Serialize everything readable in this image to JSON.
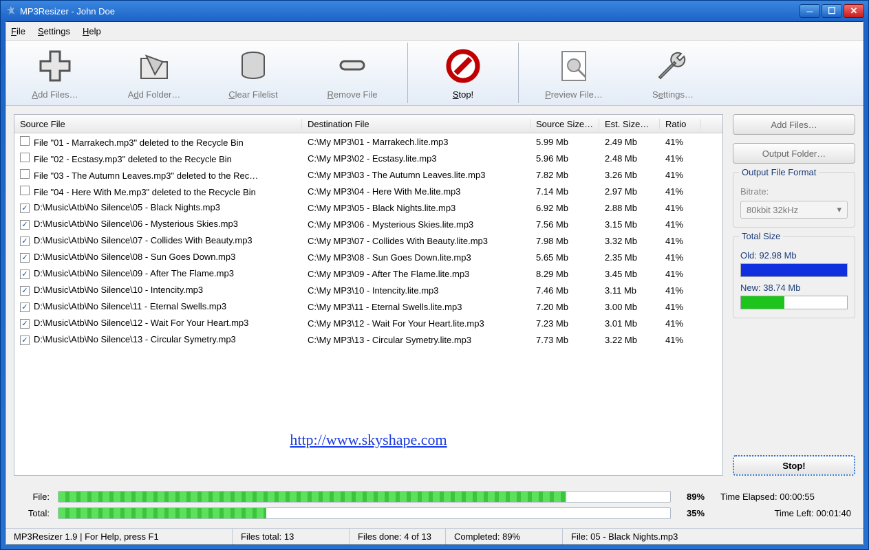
{
  "window": {
    "title": "MP3Resizer - John Doe"
  },
  "menu": {
    "file": "File",
    "settings": "Settings",
    "help": "Help"
  },
  "toolbar": {
    "add_files": "Add Files…",
    "add_folder": "Add Folder…",
    "clear": "Clear Filelist",
    "remove": "Remove File",
    "stop": "Stop!",
    "preview": "Preview File…",
    "settings": "Settings…"
  },
  "columns": {
    "source": "Source File",
    "dest": "Destination File",
    "src_size": "Source Size…",
    "est_size": "Est. Size…",
    "ratio": "Ratio"
  },
  "rows": [
    {
      "checked": false,
      "src": "File \"01 - Marrakech.mp3\" deleted to the Recycle Bin",
      "dst": "C:\\My MP3\\01 - Marrakech.lite.mp3",
      "src_size": "5.99 Mb",
      "est_size": "2.49 Mb",
      "ratio": "41%"
    },
    {
      "checked": false,
      "src": "File \"02 - Ecstasy.mp3\" deleted to the Recycle Bin",
      "dst": "C:\\My MP3\\02 - Ecstasy.lite.mp3",
      "src_size": "5.96 Mb",
      "est_size": "2.48 Mb",
      "ratio": "41%"
    },
    {
      "checked": false,
      "src": "File \"03 - The Autumn Leaves.mp3\" deleted to the Rec…",
      "dst": "C:\\My MP3\\03 - The Autumn Leaves.lite.mp3",
      "src_size": "7.82 Mb",
      "est_size": "3.26 Mb",
      "ratio": "41%"
    },
    {
      "checked": false,
      "src": "File \"04 - Here With Me.mp3\" deleted to the Recycle Bin",
      "dst": "C:\\My MP3\\04 - Here With Me.lite.mp3",
      "src_size": "7.14 Mb",
      "est_size": "2.97 Mb",
      "ratio": "41%"
    },
    {
      "checked": true,
      "src": "D:\\Music\\Atb\\No Silence\\05 - Black Nights.mp3",
      "dst": "C:\\My MP3\\05 - Black Nights.lite.mp3",
      "src_size": "6.92 Mb",
      "est_size": "2.88 Mb",
      "ratio": "41%"
    },
    {
      "checked": true,
      "src": "D:\\Music\\Atb\\No Silence\\06 - Mysterious Skies.mp3",
      "dst": "C:\\My MP3\\06 - Mysterious Skies.lite.mp3",
      "src_size": "7.56 Mb",
      "est_size": "3.15 Mb",
      "ratio": "41%"
    },
    {
      "checked": true,
      "src": "D:\\Music\\Atb\\No Silence\\07 - Collides With Beauty.mp3",
      "dst": "C:\\My MP3\\07 - Collides With Beauty.lite.mp3",
      "src_size": "7.98 Mb",
      "est_size": "3.32 Mb",
      "ratio": "41%"
    },
    {
      "checked": true,
      "src": "D:\\Music\\Atb\\No Silence\\08 - Sun Goes Down.mp3",
      "dst": "C:\\My MP3\\08 - Sun Goes Down.lite.mp3",
      "src_size": "5.65 Mb",
      "est_size": "2.35 Mb",
      "ratio": "41%"
    },
    {
      "checked": true,
      "src": "D:\\Music\\Atb\\No Silence\\09 - After The Flame.mp3",
      "dst": "C:\\My MP3\\09 - After The Flame.lite.mp3",
      "src_size": "8.29 Mb",
      "est_size": "3.45 Mb",
      "ratio": "41%"
    },
    {
      "checked": true,
      "src": "D:\\Music\\Atb\\No Silence\\10 - Intencity.mp3",
      "dst": "C:\\My MP3\\10 - Intencity.lite.mp3",
      "src_size": "7.46 Mb",
      "est_size": "3.11 Mb",
      "ratio": "41%"
    },
    {
      "checked": true,
      "src": "D:\\Music\\Atb\\No Silence\\11 - Eternal Swells.mp3",
      "dst": "C:\\My MP3\\11 - Eternal Swells.lite.mp3",
      "src_size": "7.20 Mb",
      "est_size": "3.00 Mb",
      "ratio": "41%"
    },
    {
      "checked": true,
      "src": "D:\\Music\\Atb\\No Silence\\12 - Wait For Your Heart.mp3",
      "dst": "C:\\My MP3\\12 - Wait For Your Heart.lite.mp3",
      "src_size": "7.23 Mb",
      "est_size": "3.01 Mb",
      "ratio": "41%"
    },
    {
      "checked": true,
      "src": "D:\\Music\\Atb\\No Silence\\13 - Circular Symetry.mp3",
      "dst": "C:\\My MP3\\13 - Circular Symetry.lite.mp3",
      "src_size": "7.73 Mb",
      "est_size": "3.22 Mb",
      "ratio": "41%"
    }
  ],
  "link": "http://www.skyshape.com",
  "side": {
    "add_files": "Add Files…",
    "output_folder": "Output Folder…",
    "format_title": "Output File Format",
    "bitrate_label": "Bitrate:",
    "bitrate_value": "80kbit 32kHz",
    "total_title": "Total Size",
    "old": "Old: 92.98 Mb",
    "new": "New: 38.74 Mb",
    "old_pct": 100,
    "new_pct": 41,
    "stop": "Stop!"
  },
  "progress": {
    "file_label": "File:",
    "file_pct_text": "89%",
    "file_pct": 83,
    "elapsed": "Time Elapsed: 00:00:55",
    "total_label": "Total:",
    "total_pct_text": "35%",
    "total_pct": 34,
    "left": "Time Left: 00:01:40"
  },
  "status": {
    "s1": "MP3Resizer 1.9 | For Help, press F1",
    "s2": "Files total: 13",
    "s3": "Files done: 4 of 13",
    "s4": "Completed: 89%",
    "s5": "File: 05 - Black Nights.mp3"
  }
}
